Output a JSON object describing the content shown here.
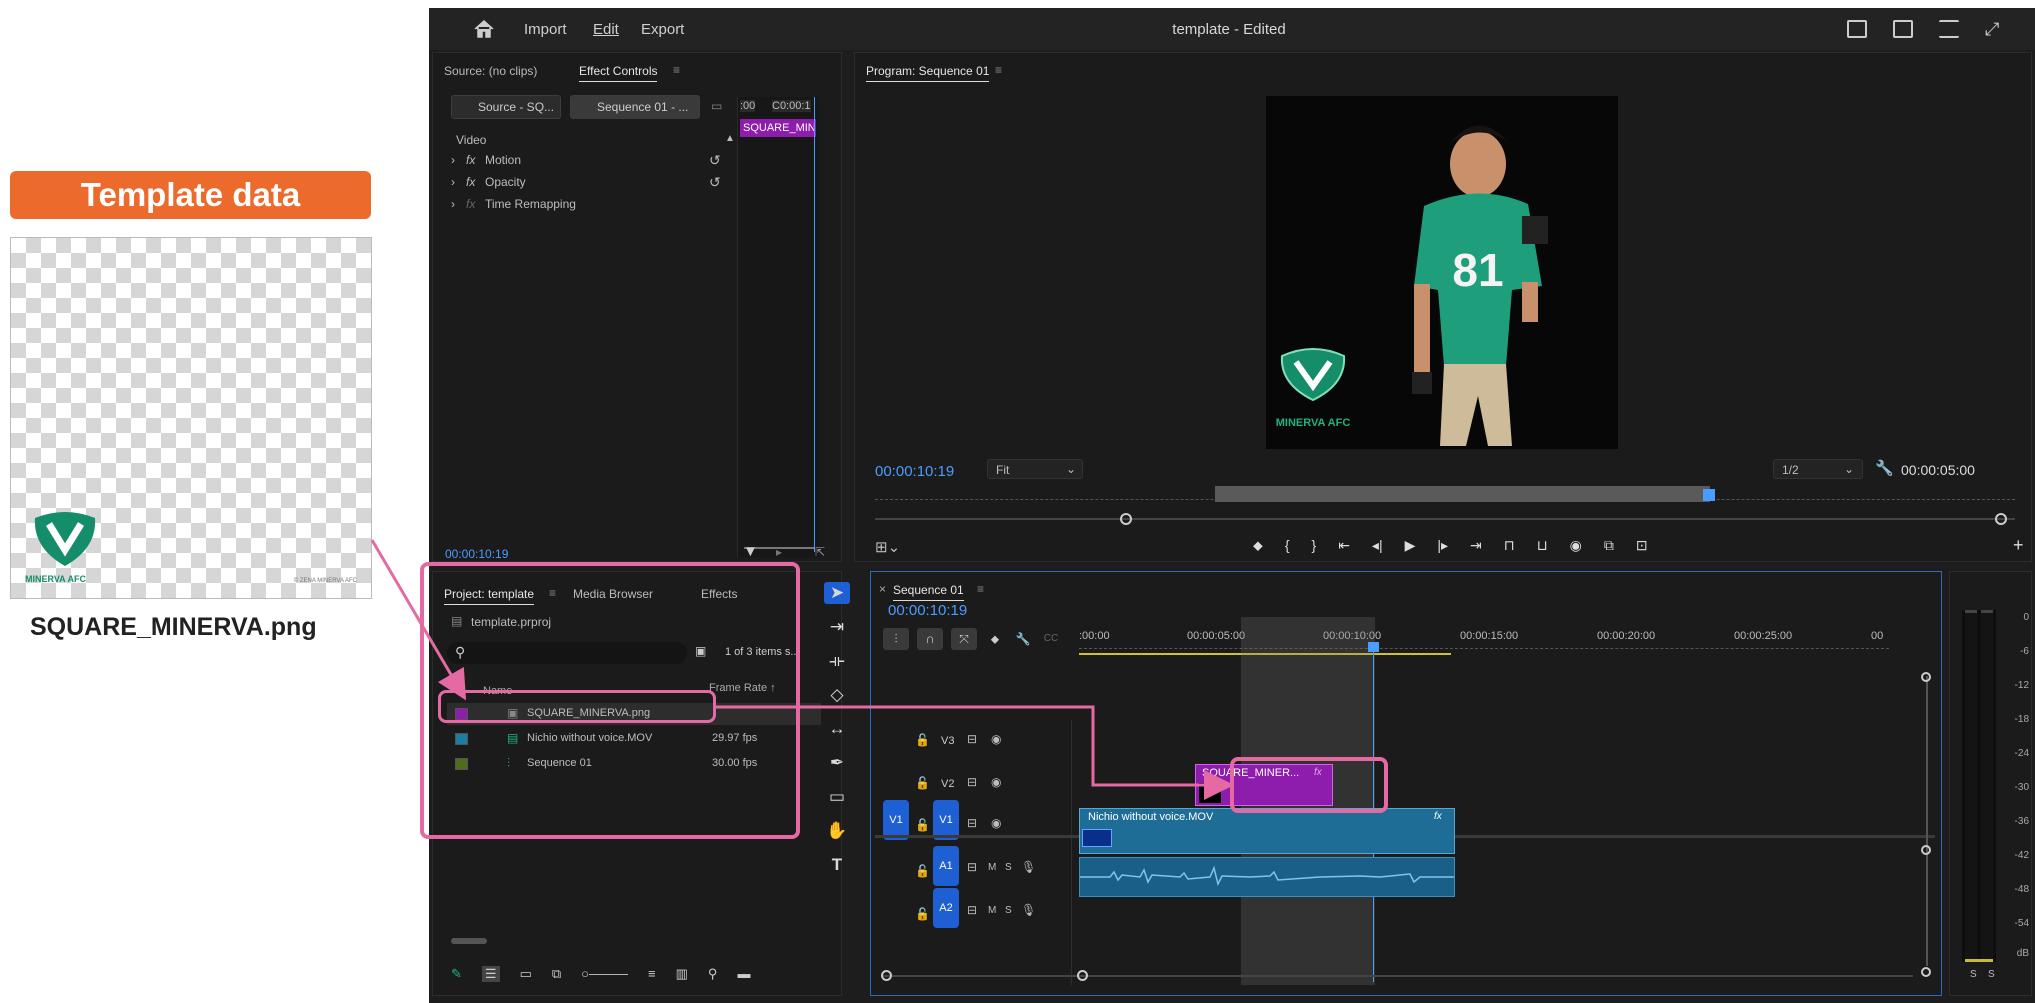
{
  "figure": {
    "template_label": "Template data",
    "caption": "SQUARE_MINERVA.png",
    "logo_text": "MINERVA AFC",
    "copyright": "© ZENA MINERVA AFC"
  },
  "titlebar": {
    "import": "Import",
    "edit": "Edit",
    "export": "Export",
    "title": "template - Edited"
  },
  "effects": {
    "tab_source": "Source: (no clips)",
    "tab_effect_controls": "Effect Controls",
    "source_chip": "Source - SQ...",
    "sequence_chip": "Sequence 01 - ...",
    "ruler_times": ":00",
    "ruler_times2": "C0:00:1",
    "clip_label": "SQUARE_MIN",
    "video_label": "Video",
    "rows": [
      {
        "label": "Motion"
      },
      {
        "label": "Opacity"
      },
      {
        "label": "Time Remapping"
      }
    ],
    "timecode": "00:00:10:19"
  },
  "program": {
    "tab": "Program: Sequence 01",
    "timecode": "00:00:10:19",
    "fit": "Fit",
    "resolution": "1/2",
    "duration": "00:00:05:00",
    "jersey_number": "81",
    "logo_text": "MINERVA AFC"
  },
  "project": {
    "tab_project": "Project: template",
    "tab_media": "Media Browser",
    "tab_effects": "Effects",
    "file": "template.prproj",
    "items_count": "1 of 3 items s...",
    "col_name": "Name",
    "col_rate": "Frame Rate",
    "items": [
      {
        "name": "SQUARE_MINERVA.png",
        "rate": "",
        "color": "#8e1cac"
      },
      {
        "name": "Nichio without voice.MOV",
        "rate": "29.97 fps",
        "color": "#1b7ea1"
      },
      {
        "name": "Sequence 01",
        "rate": "30.00 fps",
        "color": "#4e6b1e"
      }
    ]
  },
  "timeline": {
    "tab": "Sequence 01",
    "timecode": "00:00:10:19",
    "ruler": [
      ":00:00",
      "00:00:05:00",
      "00:00:10:00",
      "00:00:15:00",
      "00:00:20:00",
      "00:00:25:00",
      "00"
    ],
    "tracks": {
      "v3": "V3",
      "v2": "V2",
      "v1": "V1",
      "a1": "A1",
      "a2": "A2"
    },
    "src_v1": "V1",
    "png_clip": "SQUARE_MINER...",
    "mov_clip": "Nichio without voice.MOV"
  },
  "meter": {
    "labels": [
      "0",
      "-6",
      "-12",
      "-18",
      "-24",
      "-30",
      "-36",
      "-42",
      "-48",
      "-54",
      "dB"
    ],
    "solo_left": "S",
    "solo_right": "S"
  }
}
